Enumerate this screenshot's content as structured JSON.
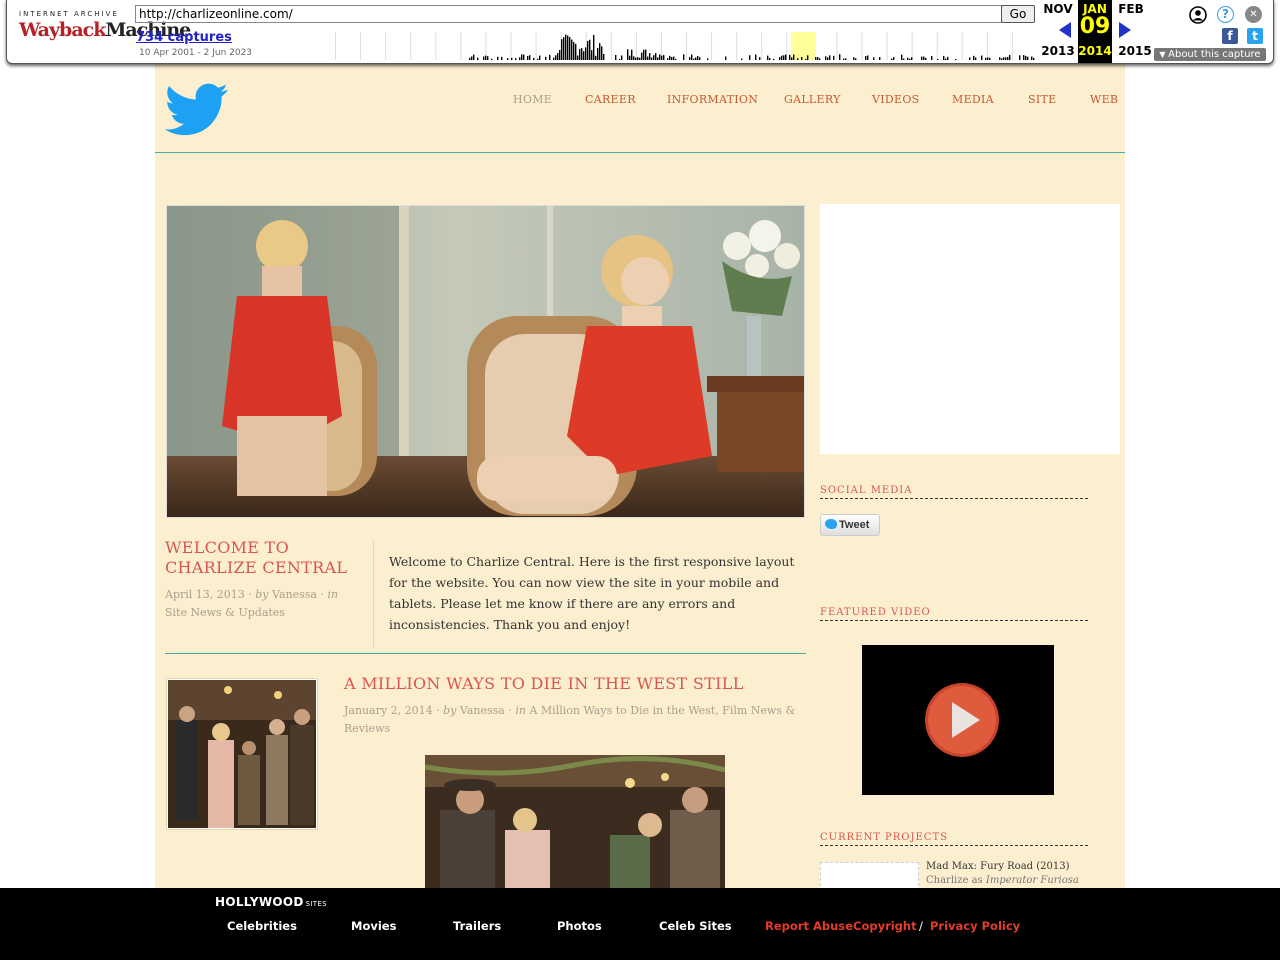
{
  "wayback": {
    "logo_top": "INTERNET ARCHIVE",
    "logo_a": "Wayback",
    "logo_b": "Machine",
    "url": "http://charlizeonline.com/",
    "go_label": "Go",
    "captures": "734 captures",
    "date_span": "10 Apr 2001 - 2 Jun 2023",
    "prev_month": "NOV",
    "prev_year": "2013",
    "cur_month": "JAN",
    "cur_day": "09",
    "cur_year": "2014",
    "next_month": "FEB",
    "next_year": "2015",
    "about": "About this capture",
    "help_glyph": "?",
    "close_glyph": "✕",
    "fb_glyph": "f",
    "tw_glyph": "t"
  },
  "nav": {
    "home": "HOME",
    "career": "CAREER",
    "information": "INFORMATION",
    "gallery": "GALLERY",
    "videos": "VIDEOS",
    "media": "MEDIA",
    "site": "SITE",
    "web": "WEB"
  },
  "featured_post": {
    "title": "WELCOME TO CHARLIZE CENTRAL",
    "date": "April 13, 2013",
    "by": "by",
    "author": "Vanessa",
    "in": "in",
    "category": "Site News & Updates",
    "sep": "·",
    "body": "Welcome to Charlize Central. Here is the first responsive layout for the website. You can now view the site in your mobile and tablets. Please let me know if there are any errors and inconsistencies. Thank you and enjoy!"
  },
  "second_post": {
    "title": "A MILLION WAYS TO DIE IN THE WEST STILL",
    "date": "January 2, 2014",
    "by": "by",
    "author": "Vanessa",
    "in": "in",
    "categories": "A Million Ways to Die in the West, Film News & Reviews",
    "sep": "·"
  },
  "sidebar": {
    "social_heading": "SOCIAL MEDIA",
    "tweet_label": "Tweet",
    "video_heading": "FEATURED VIDEO",
    "projects_heading": "CURRENT PROJECTS",
    "project_title": "Mad Max: Fury Road (2013)",
    "project_role_prefix": "Charlize as",
    "project_role": "Imperator Furiosa"
  },
  "footer": {
    "brand": "HOLLYWOOD",
    "brand_sub": "SITES",
    "celebrities": "Celebrities",
    "movies": "Movies",
    "trailers": "Trailers",
    "photos": "Photos",
    "celeb_sites": "Celeb Sites",
    "report": "Report Abuse",
    "copyright": "Copyright",
    "slash": "/",
    "privacy": "Privacy Policy"
  },
  "colors": {
    "page_bg": "#fcefd0",
    "accent_red": "#d9564f",
    "nav_orange": "#c85a2f",
    "teal_rule": "#4aaca1",
    "twitter_blue": "#1da1f2"
  }
}
